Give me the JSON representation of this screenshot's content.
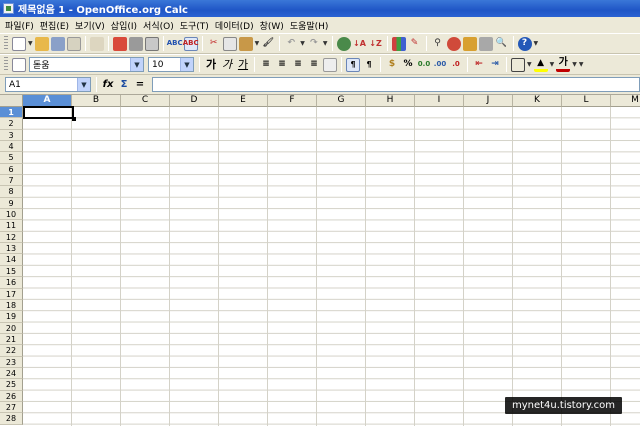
{
  "window": {
    "title": "제목없음 1 - OpenOffice.org Calc"
  },
  "menu": [
    "파일(F)",
    "편집(E)",
    "보기(V)",
    "삽입(I)",
    "서식(O)",
    "도구(T)",
    "데이터(D)",
    "창(W)",
    "도움말(H)"
  ],
  "toolbar2": {
    "font_name": "돋움",
    "font_size": "10",
    "bold_label": "가",
    "italic_label": "가",
    "underline_label": "가",
    "percent_label": "%",
    "font_color_label": "가"
  },
  "formula_bar": {
    "name_box": "A1",
    "fx_label": "fx",
    "sum_label": "Σ",
    "equals_label": "=",
    "content": ""
  },
  "sheet": {
    "columns": [
      "A",
      "B",
      "C",
      "D",
      "E",
      "F",
      "G",
      "H",
      "I",
      "J",
      "K",
      "L",
      "M"
    ],
    "rows": [
      "1",
      "2",
      "3",
      "4",
      "5",
      "6",
      "7",
      "8",
      "9",
      "10",
      "11",
      "12",
      "13",
      "14",
      "15",
      "16",
      "17",
      "18",
      "19",
      "20",
      "21",
      "22",
      "23",
      "24",
      "25",
      "26",
      "27",
      "28"
    ],
    "active_column": "A",
    "active_row": "1"
  },
  "watermark": "mynet4u.tistory.com",
  "colors": {
    "titlebar": "#2a62d2",
    "header_active": "#5a8fd6",
    "chrome": "#ece9d8"
  }
}
